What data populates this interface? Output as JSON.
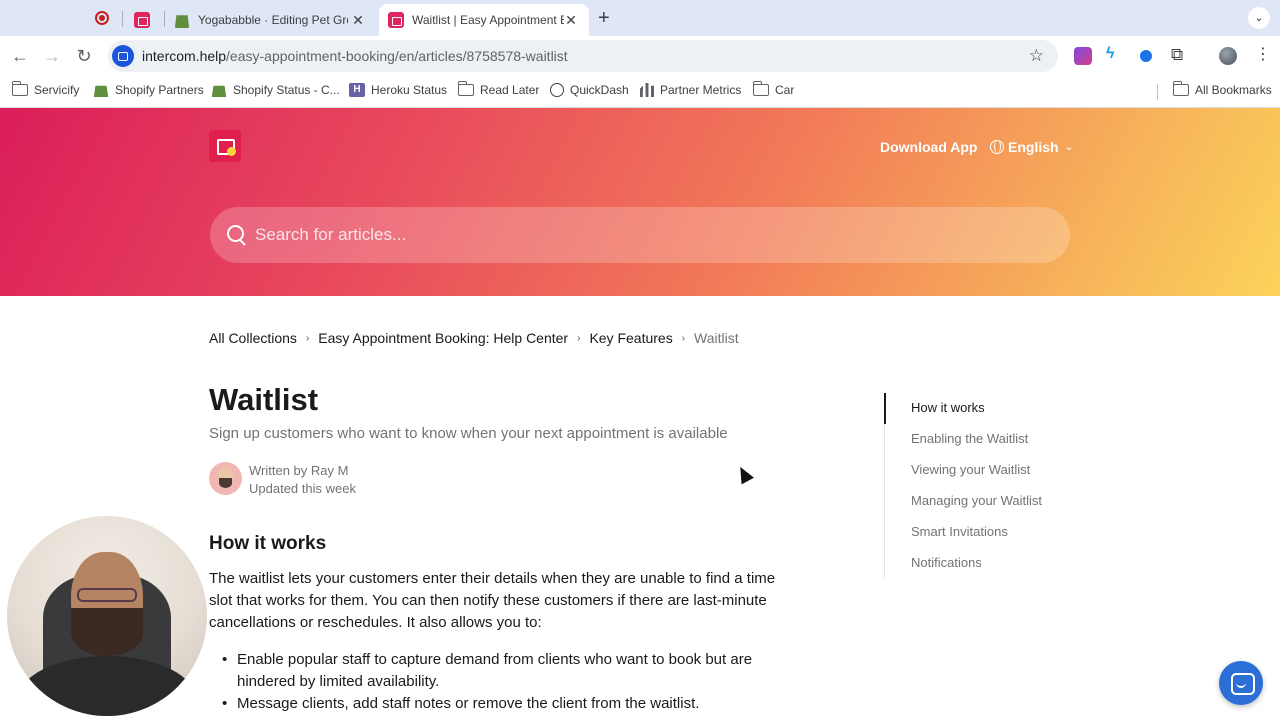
{
  "browser": {
    "tabs": [
      {
        "title": "",
        "icon": "recording-icon"
      },
      {
        "title": "",
        "icon": "appointment-app-icon"
      },
      {
        "title": "Yogababble · Editing Pet Groo",
        "icon": "shopify-icon"
      },
      {
        "title": "Waitlist | Easy Appointment B",
        "icon": "appointment-app-icon",
        "active": true
      }
    ],
    "url_host": "intercom.help",
    "url_path": "/easy-appointment-booking/en/articles/8758578-waitlist",
    "bookmarks": [
      {
        "label": "Servicify",
        "icon": "folder-icon"
      },
      {
        "label": "Shopify Partners",
        "icon": "shopify-icon"
      },
      {
        "label": "Shopify Status - C...",
        "icon": "shopify-icon"
      },
      {
        "label": "Heroku Status",
        "icon": "heroku-icon"
      },
      {
        "label": "Read Later",
        "icon": "folder-icon"
      },
      {
        "label": "QuickDash",
        "icon": "globe-icon"
      },
      {
        "label": "Partner Metrics",
        "icon": "chart-icon"
      },
      {
        "label": "Car",
        "icon": "folder-icon"
      }
    ],
    "all_bookmarks": "All Bookmarks"
  },
  "header": {
    "download_app": "Download App",
    "language": "English",
    "search_placeholder": "Search for articles..."
  },
  "breadcrumb": [
    "All Collections",
    "Easy Appointment Booking: Help Center",
    "Key Features",
    "Waitlist"
  ],
  "article": {
    "title": "Waitlist",
    "subtitle": "Sign up customers who want to know when your next appointment is available",
    "author": "Written by Ray M",
    "updated": "Updated this week",
    "section_heading": "How it works",
    "paragraph": "The waitlist lets your customers enter their details when they are unable to find a time slot that works for them. You can then notify these customers if there are last-minute cancellations or reschedules. It also allows you to:",
    "bullets": [
      "Enable popular staff to capture demand from clients who want to book but are hindered by limited availability.",
      "Message clients, add staff notes or remove the client from the waitlist."
    ]
  },
  "toc": {
    "items": [
      "How it works",
      "Enabling the Waitlist",
      "Viewing your Waitlist",
      "Managing your Waitlist",
      "Smart Invitations",
      "Notifications"
    ],
    "active_index": 0
  },
  "colors": {
    "hero_gradient": [
      "#db1e5a",
      "#f27c58",
      "#fbd35a"
    ],
    "chat_button": "#2b6fd6"
  }
}
